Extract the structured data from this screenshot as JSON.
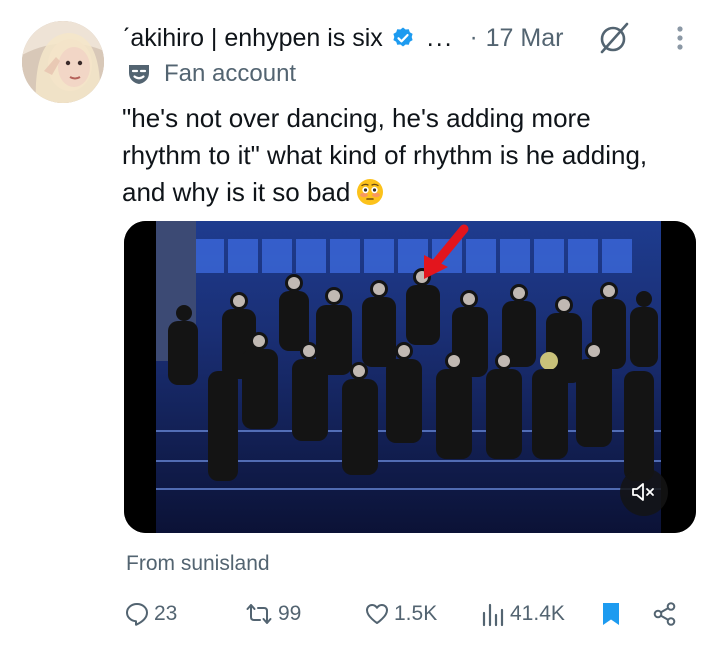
{
  "tweet": {
    "display_name": "ˊakihiro | enhypen is six",
    "ellipsis": "...",
    "separator": "·",
    "date": "17 Mar",
    "label": "Fan account",
    "text_line1": "\"he's not over dancing, he's adding more",
    "text_line2": "rhythm to it\"  what kind of rhythm is he adding,",
    "text_line3": "and why is it so bad",
    "emoji": "flushed-face",
    "source": "From sunisland"
  },
  "actions": {
    "replies": "23",
    "reposts": "99",
    "likes": "1.5K",
    "views": "41.4K"
  },
  "colors": {
    "accent": "#1d9bf0",
    "secondary_text": "#536471",
    "primary_text": "#0f1419"
  },
  "icons": [
    "verified-icon",
    "grok-icon",
    "more-icon",
    "fan-account-icon",
    "mute-icon",
    "reply-icon",
    "repost-icon",
    "like-icon",
    "views-icon",
    "bookmark-icon",
    "share-icon"
  ]
}
